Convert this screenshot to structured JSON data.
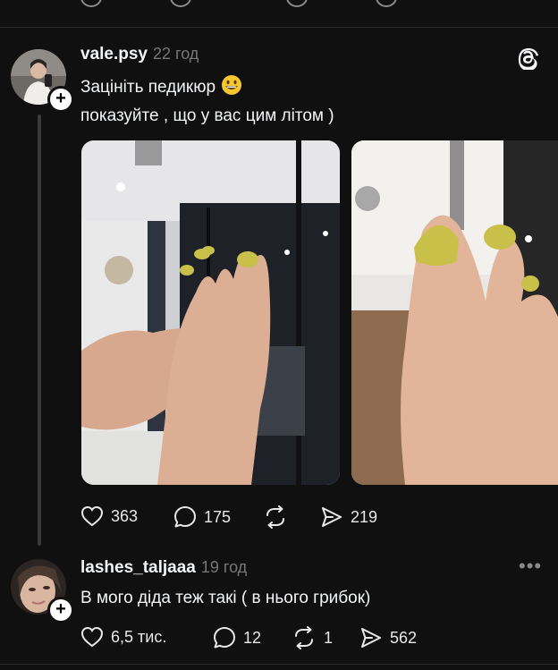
{
  "post1": {
    "username": "vale.psy",
    "time": "22 год",
    "line1": "Зацініть педикюр",
    "line2": "показуйте , що у вас цим літом )",
    "likes": "363",
    "comments": "175",
    "reposts": "",
    "shares": "219"
  },
  "post2": {
    "username": "lashes_taljaaa",
    "time": "19 год",
    "text": "В мого діда теж такі ( в нього грибок)",
    "likes": "6,5 тис.",
    "comments": "12",
    "reposts": "1",
    "shares": "562"
  },
  "icons": {
    "logo": "threads-logo-icon",
    "like": "heart-icon",
    "comment": "comment-bubble-icon",
    "repost": "repost-icon",
    "share": "send-icon",
    "more": "more-options-icon",
    "emoji": "grinning-face-emoji"
  },
  "colors": {
    "background": "#101010",
    "text": "#f3f5f7",
    "muted": "#777777",
    "nail_yellow": "#c9c04a"
  }
}
